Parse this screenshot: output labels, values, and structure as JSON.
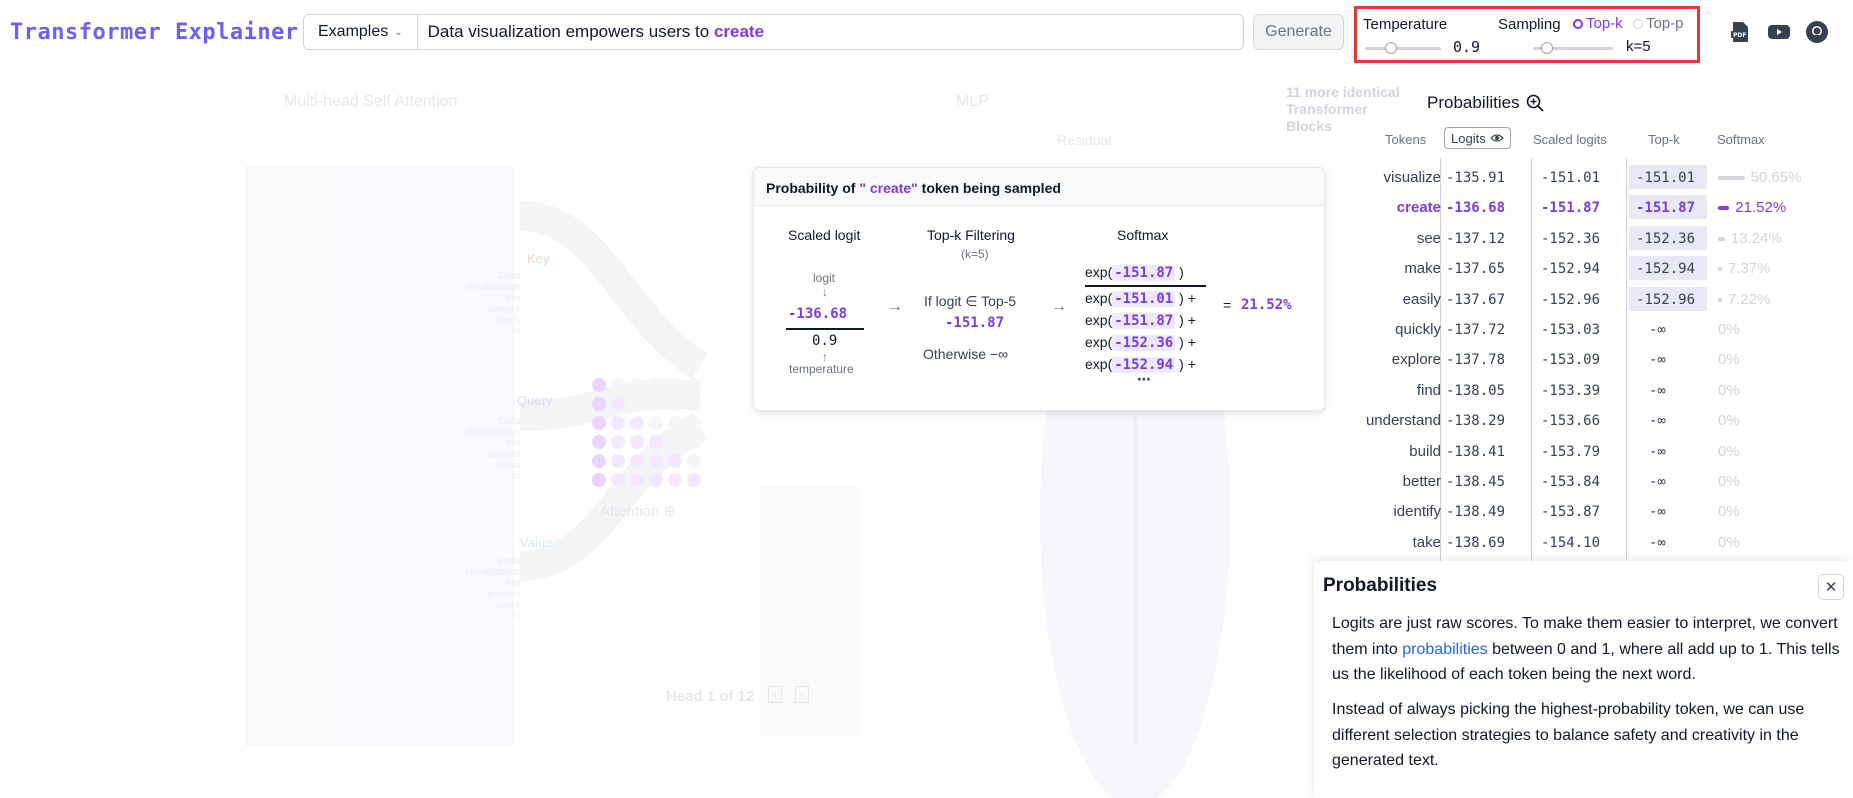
{
  "header": {
    "logo": "Transformer Explainer",
    "examples_label": "Examples",
    "prompt_prefix": "Data visualization empowers users to",
    "prompt_highlight": "create",
    "generate_label": "Generate",
    "temperature_label": "Temperature",
    "temperature_value": "0.9",
    "sampling_label": "Sampling",
    "topk_label": "Top-k",
    "topp_label": "Top-p",
    "topk_value": "k=5",
    "icons": [
      "pdf-icon",
      "youtube-icon",
      "github-icon"
    ]
  },
  "diagram": {
    "attention_title": "Multi-head Self Attention",
    "mlp_title": "MLP",
    "residual_label": "Residual",
    "blocks_note": "11 more identical Transformer Blocks",
    "key_label": "Key",
    "query_label": "Query",
    "value_label": "Value",
    "attention_label": "Attention",
    "head_label": "Head 1 of 12",
    "tokens": [
      "Data",
      "visualization",
      "em",
      "powers",
      "users",
      "to"
    ]
  },
  "probabilities": {
    "title": "Probabilities",
    "columns": {
      "tokens": "Tokens",
      "logits": "Logits",
      "scaled": "Scaled logits",
      "topk": "Top-k",
      "softmax": "Softmax"
    },
    "rows": [
      {
        "token": "visualize",
        "logit": "-135.91",
        "scaled": "-151.01",
        "topk": "-151.01",
        "softmax": "50.65%",
        "prob": 0.5065,
        "selected": false
      },
      {
        "token": "create",
        "logit": "-136.68",
        "scaled": "-151.87",
        "topk": "-151.87",
        "softmax": "21.52%",
        "prob": 0.2152,
        "selected": true
      },
      {
        "token": "see",
        "logit": "-137.12",
        "scaled": "-152.36",
        "topk": "-152.36",
        "softmax": "13.24%",
        "prob": 0.1324,
        "selected": false
      },
      {
        "token": "make",
        "logit": "-137.65",
        "scaled": "-152.94",
        "topk": "-152.94",
        "softmax": "7.37%",
        "prob": 0.0737,
        "selected": false
      },
      {
        "token": "easily",
        "logit": "-137.67",
        "scaled": "-152.96",
        "topk": "-152.96",
        "softmax": "7.22%",
        "prob": 0.0722,
        "selected": false
      },
      {
        "token": "quickly",
        "logit": "-137.72",
        "scaled": "-153.03",
        "topk": "-∞",
        "softmax": "0%",
        "prob": 0,
        "selected": false
      },
      {
        "token": "explore",
        "logit": "-137.78",
        "scaled": "-153.09",
        "topk": "-∞",
        "softmax": "0%",
        "prob": 0,
        "selected": false
      },
      {
        "token": "find",
        "logit": "-138.05",
        "scaled": "-153.39",
        "topk": "-∞",
        "softmax": "0%",
        "prob": 0,
        "selected": false
      },
      {
        "token": "understand",
        "logit": "-138.29",
        "scaled": "-153.66",
        "topk": "-∞",
        "softmax": "0%",
        "prob": 0,
        "selected": false
      },
      {
        "token": "build",
        "logit": "-138.41",
        "scaled": "-153.79",
        "topk": "-∞",
        "softmax": "0%",
        "prob": 0,
        "selected": false
      },
      {
        "token": "better",
        "logit": "-138.45",
        "scaled": "-153.84",
        "topk": "-∞",
        "softmax": "0%",
        "prob": 0,
        "selected": false
      },
      {
        "token": "identify",
        "logit": "-138.49",
        "scaled": "-153.87",
        "topk": "-∞",
        "softmax": "0%",
        "prob": 0,
        "selected": false
      },
      {
        "token": "take",
        "logit": "-138.69",
        "scaled": "-154.10",
        "topk": "-∞",
        "softmax": "0%",
        "prob": 0,
        "selected": false
      }
    ]
  },
  "popup": {
    "title_prefix": "Probability of",
    "title_token": "\" create\"",
    "title_suffix": "token being sampled",
    "scaled_logit_label": "Scaled logit",
    "topk_filter_label": "Top-k Filtering",
    "topk_k": "(k=5)",
    "softmax_label": "Softmax",
    "logit_label": "logit",
    "logit_value": "-136.68",
    "temperature_value": "0.9",
    "temperature_label": "temperature",
    "if_label": "If logit ∈ Top-5",
    "if_value": "-151.87",
    "otherwise_label": "Otherwise −∞",
    "numerator": "-151.87",
    "denominators": [
      "-151.01",
      "-151.87",
      "-152.36",
      "-152.94"
    ],
    "result": "21.52%"
  },
  "info": {
    "title": "Probabilities",
    "p1_a": "Logits are just raw scores. To make them easier to interpret, we convert them into",
    "p1_link": "probabilities",
    "p1_b": "between 0 and 1, where all add up to 1. This tells us the likelihood of each token being the next word.",
    "p2": "Instead of always picking the highest-probability token, we can use different selection strategies to balance safety and creativity in the generated text."
  },
  "colors": {
    "accent": "#7c3aed",
    "logo": "#6d5dfc",
    "highlight_border": "#e53935",
    "link": "#2563eb"
  }
}
